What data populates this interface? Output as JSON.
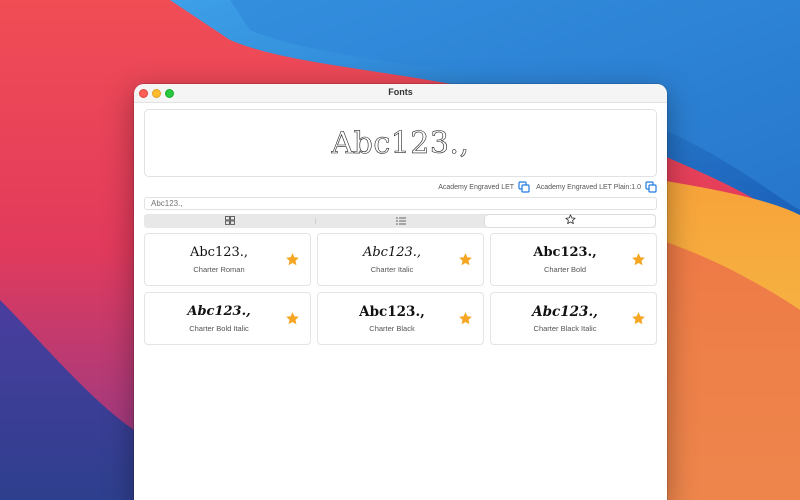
{
  "window": {
    "title": "Fonts"
  },
  "preview": {
    "text": "Abc123.,"
  },
  "font_info": {
    "family": "Academy Engraved LET",
    "full_name": "Academy Engraved LET Plain:1.0"
  },
  "search": {
    "value": "",
    "placeholder": "Abc123.,"
  },
  "view_tabs": [
    {
      "icon": "grid-icon",
      "active": false
    },
    {
      "icon": "list-icon",
      "active": false
    },
    {
      "icon": "star-outline-icon",
      "active": true
    }
  ],
  "colors": {
    "star": "#f5a623",
    "copy_icon": "#1f7ae0"
  },
  "fonts": [
    {
      "sample": "Abc123.,",
      "name": "Charter Roman",
      "style": "regular",
      "favorite": true
    },
    {
      "sample": "Abc123.,",
      "name": "Charter Italic",
      "style": "italic",
      "favorite": true
    },
    {
      "sample": "Abc123.,",
      "name": "Charter Bold",
      "style": "bold",
      "favorite": true
    },
    {
      "sample": "Abc123.,",
      "name": "Charter Bold Italic",
      "style": "bold-italic",
      "favorite": true
    },
    {
      "sample": "Abc123.,",
      "name": "Charter Black",
      "style": "black",
      "favorite": true
    },
    {
      "sample": "Abc123.,",
      "name": "Charter Black Italic",
      "style": "black-italic",
      "favorite": true
    }
  ]
}
